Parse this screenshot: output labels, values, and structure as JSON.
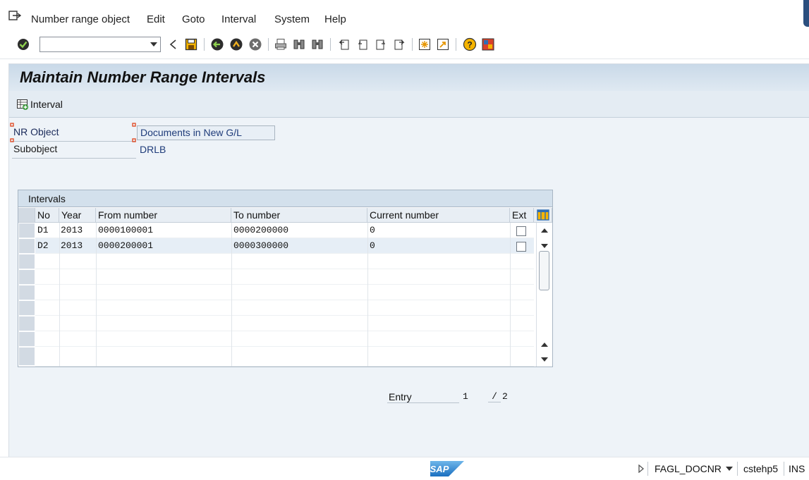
{
  "menu": {
    "items": [
      {
        "label": "Number range object"
      },
      {
        "label": "Edit"
      },
      {
        "label": "Goto"
      },
      {
        "label": "Interval"
      },
      {
        "label": "System"
      },
      {
        "label": "Help"
      }
    ]
  },
  "toolbar": {
    "command_value": "",
    "icons": [
      "enter-icon",
      "back-triangle-icon",
      "save-icon",
      "back-icon",
      "exit-icon",
      "cancel-icon",
      "print-icon",
      "find-icon",
      "find-next-icon",
      "first-page-icon",
      "previous-page-icon",
      "next-page-icon",
      "last-page-icon",
      "new-session-icon",
      "shortcut-icon",
      "help-icon",
      "customize-layout-icon"
    ]
  },
  "screen": {
    "title": "Maintain Number Range Intervals",
    "app_button": "Interval"
  },
  "form": {
    "nr_object_label": "NR Object",
    "nr_object_value": "Documents in New G/L",
    "subobject_label": "Subobject",
    "subobject_value": "DRLB"
  },
  "intervals": {
    "caption": "Intervals",
    "columns": [
      "No",
      "Year",
      "From number",
      "To number",
      "Current number",
      "Ext"
    ],
    "rows": [
      {
        "no": "D1",
        "year": "2013",
        "from": "0000100001",
        "to": "0000200000",
        "current": "0",
        "ext": false
      },
      {
        "no": "D2",
        "year": "2013",
        "from": "0000200001",
        "to": "0000300000",
        "current": "0",
        "ext": false
      }
    ]
  },
  "entry": {
    "label": "Entry",
    "current": "1",
    "slash": "/",
    "total": "2"
  },
  "status": {
    "transaction": "FAGL_DOCNR",
    "system": "cstehp5",
    "mode": "INS",
    "logo_text": "SAP"
  }
}
